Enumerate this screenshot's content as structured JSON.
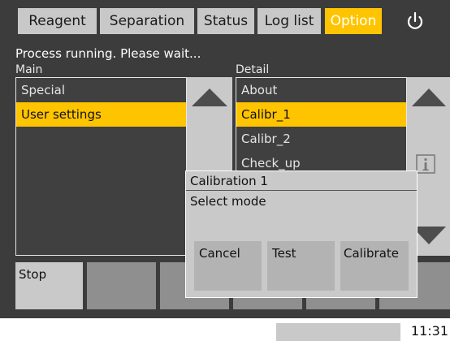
{
  "tabs": [
    {
      "label": "Reagent",
      "active": false
    },
    {
      "label": "Separation",
      "active": false
    },
    {
      "label": "Status",
      "active": false
    },
    {
      "label": "Log list",
      "active": false
    },
    {
      "label": "Option",
      "active": true
    }
  ],
  "power_icon": "power-icon",
  "status_message": "Process running. Please wait...",
  "main_panel": {
    "label": "Main",
    "items": [
      "Special",
      "User settings"
    ],
    "selected": "User settings"
  },
  "detail_panel": {
    "label": "Detail",
    "items": [
      "About",
      "Calibr_1",
      "Calibr_2",
      "Check_up"
    ],
    "selected": "Calibr_1"
  },
  "bottom_bar": {
    "stop_label": "Stop"
  },
  "dialog": {
    "title": "Calibration 1",
    "message": "Select mode",
    "buttons": [
      "Cancel",
      "Test",
      "Calibrate"
    ]
  },
  "statusbar": {
    "time": "11:31"
  },
  "colors": {
    "accent": "#ffc400",
    "background": "#3c3c3c",
    "button": "#c9c9c9"
  }
}
